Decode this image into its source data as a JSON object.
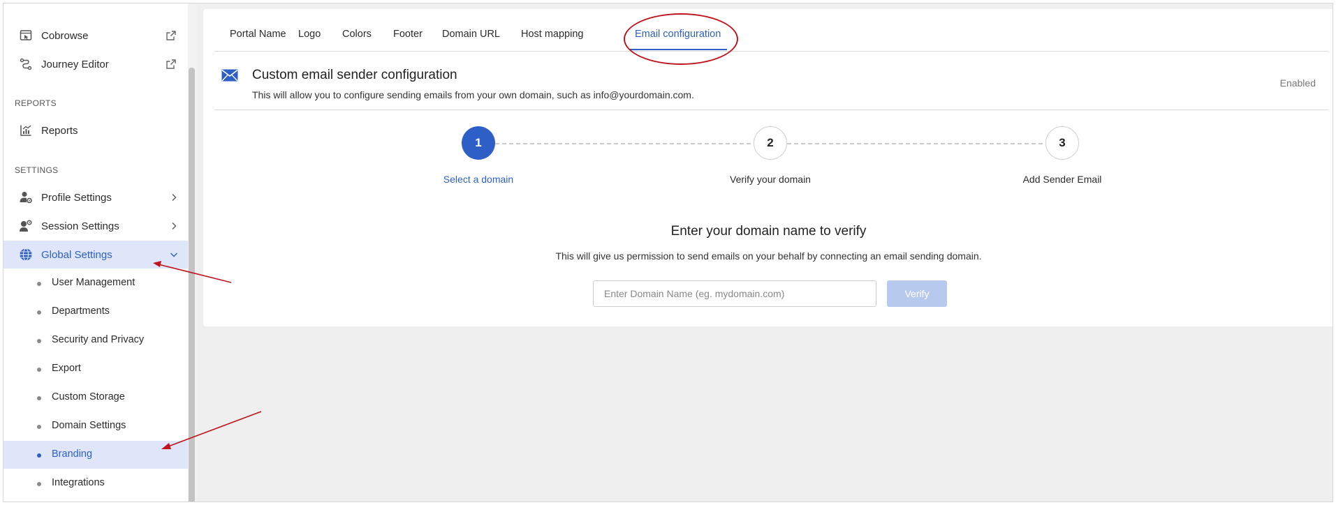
{
  "colors": {
    "accent": "#2d5fc7",
    "active_bg": "#dfe6fa",
    "annotation": "#c0141c",
    "verify_disabled": "#b8c9ee"
  },
  "sidebar": {
    "top_items": [
      {
        "label": "Cobrowse",
        "icon": "cobrowse-icon",
        "trailing": "external-link-icon"
      },
      {
        "label": "Journey Editor",
        "icon": "journey-icon",
        "trailing": "external-link-icon"
      }
    ],
    "reports_section": "REPORTS",
    "reports_item": {
      "label": "Reports",
      "icon": "reports-icon"
    },
    "settings_section": "SETTINGS",
    "settings_items": [
      {
        "label": "Profile Settings",
        "icon": "profile-settings-icon",
        "trailing": "chevron-right-icon"
      },
      {
        "label": "Session Settings",
        "icon": "session-settings-icon",
        "trailing": "chevron-right-icon"
      },
      {
        "label": "Global Settings",
        "icon": "globe-icon",
        "trailing": "chevron-down-icon",
        "active": true
      }
    ],
    "global_sub_items": [
      {
        "label": "User Management"
      },
      {
        "label": "Departments"
      },
      {
        "label": "Security and Privacy"
      },
      {
        "label": "Export"
      },
      {
        "label": "Custom Storage"
      },
      {
        "label": "Domain Settings"
      },
      {
        "label": "Branding",
        "active": true
      },
      {
        "label": "Integrations"
      }
    ]
  },
  "tabs": [
    {
      "label": "Portal Name"
    },
    {
      "label": "Logo"
    },
    {
      "label": "Colors"
    },
    {
      "label": "Footer"
    },
    {
      "label": "Domain URL"
    },
    {
      "label": "Host mapping"
    },
    {
      "label": "Email configuration",
      "active": true
    }
  ],
  "email_config": {
    "icon": "envelope-icon",
    "title": "Custom email sender configuration",
    "description": "This will allow you to configure sending emails from your own domain, such as info@yourdomain.com.",
    "status": "Enabled"
  },
  "stepper": {
    "current_step": 1,
    "steps": [
      {
        "number": "1",
        "label": "Select a domain"
      },
      {
        "number": "2",
        "label": "Verify your domain"
      },
      {
        "number": "3",
        "label": "Add Sender Email"
      }
    ]
  },
  "verify": {
    "title": "Enter your domain name to verify",
    "description": "This will give us permission to send emails on your behalf by connecting an email sending domain.",
    "input_placeholder": "Enter Domain Name (eg. mydomain.com)",
    "input_value": "",
    "button_label": "Verify"
  }
}
